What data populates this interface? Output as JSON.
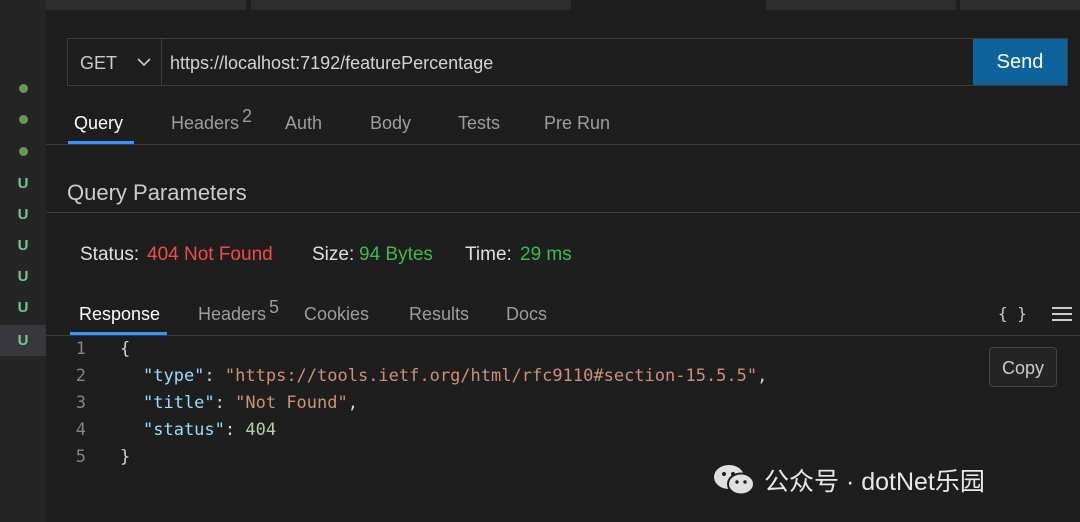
{
  "colors": {
    "accent": "#3794ff",
    "send_button": "#0e639c",
    "status_error": "#f14c4c",
    "status_ok": "#3fb950"
  },
  "gutter": {
    "markers": [
      "dot",
      "dot",
      "dot",
      "U",
      "U",
      "U",
      "U",
      "U",
      "U"
    ]
  },
  "request": {
    "method": "GET",
    "url": "https://localhost:7192/featurePercentage",
    "send_label": "Send",
    "tabs": [
      {
        "label": "Query",
        "active": true
      },
      {
        "label": "Headers",
        "badge": "2"
      },
      {
        "label": "Auth"
      },
      {
        "label": "Body"
      },
      {
        "label": "Tests"
      },
      {
        "label": "Pre Run"
      }
    ]
  },
  "query_params": {
    "title": "Query Parameters"
  },
  "status_bar": {
    "status_label": "Status:",
    "status_value": "404 Not Found",
    "size_label": "Size:",
    "size_value": "94 Bytes",
    "time_label": "Time:",
    "time_value": "29 ms"
  },
  "response": {
    "tabs": [
      {
        "label": "Response",
        "active": true
      },
      {
        "label": "Headers",
        "badge": "5"
      },
      {
        "label": "Cookies"
      },
      {
        "label": "Results"
      },
      {
        "label": "Docs"
      }
    ],
    "braces_icon": "{ }",
    "copy_label": "Copy",
    "lines": [
      {
        "num": "1",
        "open": "{"
      },
      {
        "num": "2",
        "key": "\"type\"",
        "colon": ": ",
        "value": "\"https://tools.ietf.org/html/rfc9110#section-15.5.5\"",
        "tail": ","
      },
      {
        "num": "3",
        "key": "\"title\"",
        "colon": ": ",
        "value": "\"Not Found\"",
        "tail": ","
      },
      {
        "num": "4",
        "key": "\"status\"",
        "colon": ": ",
        "value": "404",
        "tail": ""
      },
      {
        "num": "5",
        "open": "}"
      }
    ]
  },
  "watermark": {
    "text": "公众号 · dotNet乐园",
    "icon": "wechat-icon"
  }
}
